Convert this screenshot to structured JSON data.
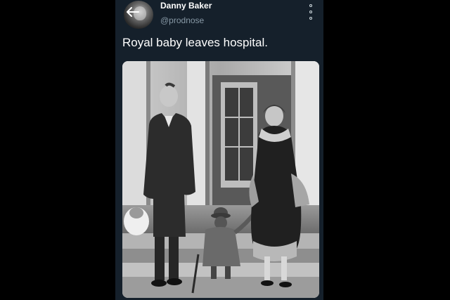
{
  "tweet": {
    "author": {
      "display_name": "Danny Baker",
      "handle": "@prodnose",
      "avatar_icon": "avatar-photo"
    },
    "text": "Royal baby leaves hospital.",
    "back_icon": "arrow-left-icon",
    "more_icon": "more-options-icon",
    "media": {
      "kind": "black-and-white photograph",
      "icon": "photo"
    }
  },
  "colors": {
    "background": "#000000",
    "card": "#15202b",
    "text": "#ffffff",
    "secondary_text": "#8899a6"
  }
}
